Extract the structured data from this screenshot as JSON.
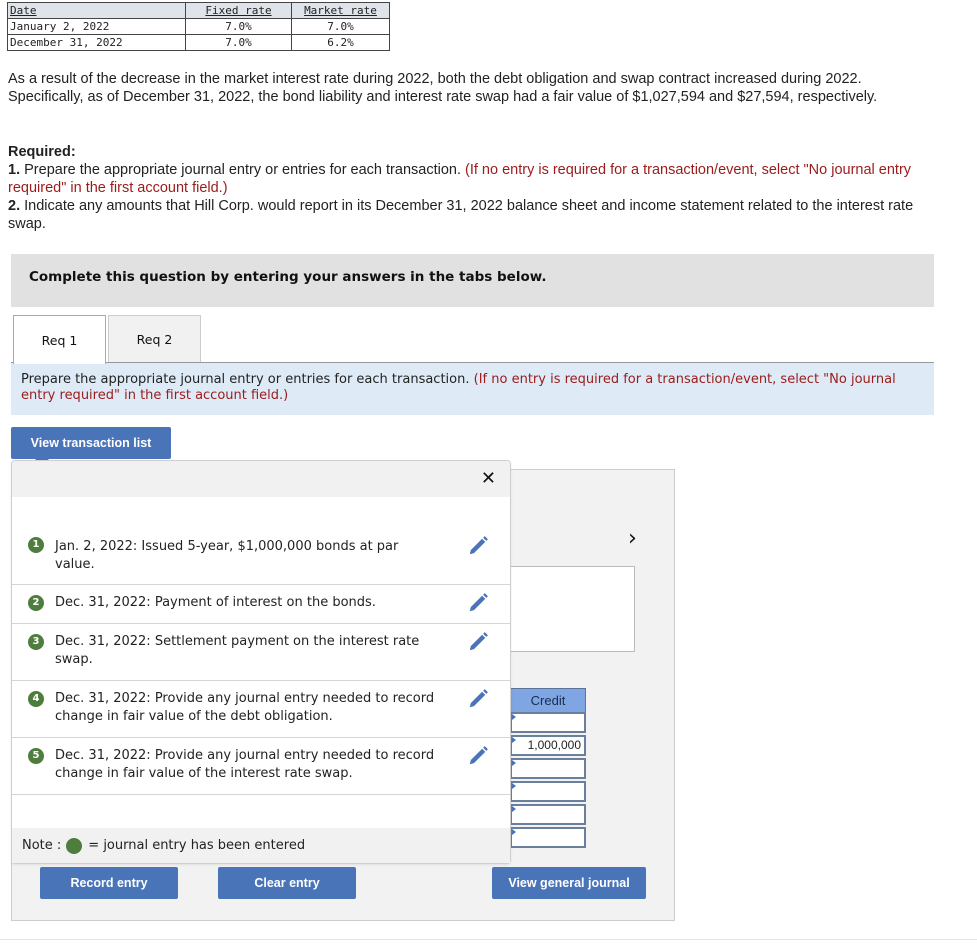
{
  "rate_table": {
    "headers": [
      "Date",
      "Fixed rate",
      "Market rate"
    ],
    "rows": [
      [
        "January 2, 2022",
        "7.0%",
        "7.0%"
      ],
      [
        "December 31, 2022",
        "7.0%",
        "6.2%"
      ]
    ]
  },
  "intro_paragraph": "As a result of the decrease in the market interest rate during 2022, both the debt obligation and swap contract increased during 2022.  Specifically, as of December 31, 2022, the bond liability and interest rate swap had a fair value of $1,027,594 and $27,594, respectively.",
  "required": {
    "heading": "Required:",
    "item1_num": "1.",
    "item1_text": "Prepare the appropriate journal entry or entries for each transaction.",
    "item1_note": "(If no entry is required for a transaction/event, select \"No journal entry required\" in the first account field.)",
    "item2_num": "2.",
    "item2_text": "Indicate any amounts that Hill Corp. would report in its December 31, 2022 balance sheet and income statement related to the interest rate swap."
  },
  "banner": "Complete this question by entering your answers in the tabs below.",
  "tabs": [
    {
      "label": "Req 1",
      "active": true
    },
    {
      "label": "Req 2",
      "active": false
    }
  ],
  "instructions": {
    "text": "Prepare the appropriate journal entry or entries for each transaction.",
    "note": "(If no entry is required for a transaction/event, select \"No journal entry required\" in the first account field.)"
  },
  "buttons": {
    "view_transaction_list": "View transaction list",
    "record_entry": "Record entry",
    "clear_entry": "Clear entry",
    "view_general_journal": "View general journal"
  },
  "transactions": [
    {
      "num": "1",
      "text": "Jan. 2, 2022: Issued 5-year, $1,000,000 bonds at par value.",
      "entered": true
    },
    {
      "num": "2",
      "text": "Dec. 31, 2022: Payment of interest on the bonds.",
      "entered": true
    },
    {
      "num": "3",
      "text": "Dec. 31, 2022: Settlement payment on the interest rate swap.",
      "entered": true
    },
    {
      "num": "4",
      "text": "Dec. 31, 2022: Provide any journal entry needed to record change in fair value of the debt obligation.",
      "entered": true
    },
    {
      "num": "5",
      "text": "Dec. 31, 2022: Provide any journal entry needed to record change in fair value of the interest rate swap.",
      "entered": true
    }
  ],
  "note": {
    "prefix": "Note :",
    "suffix": "= journal entry has been entered"
  },
  "journal": {
    "credit_header": "Credit",
    "credit_values": [
      "",
      "1,000,000",
      "",
      "",
      "",
      ""
    ]
  },
  "colors": {
    "button_blue": "#4a74b8",
    "entered_green": "#4e7d3e",
    "note_red": "#9b1b1b",
    "instruction_bg": "#deebf7"
  }
}
